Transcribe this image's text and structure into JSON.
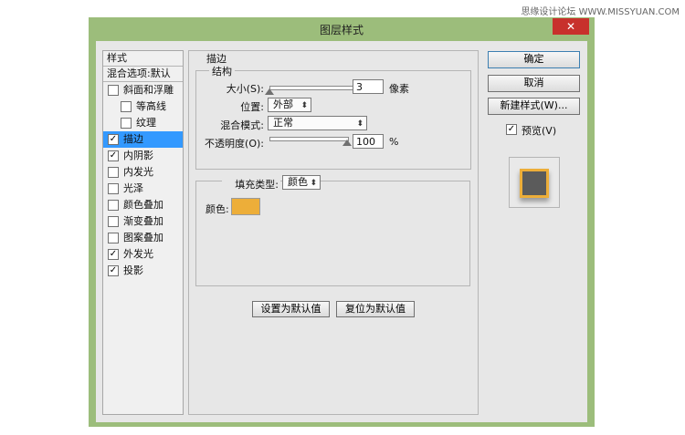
{
  "watermark": "思缘设计论坛 WWW.MISSYUAN.COM",
  "window": {
    "title": "图层样式",
    "close_glyph": "✕"
  },
  "style_list": {
    "header": "样式",
    "blend_options": "混合选项:默认",
    "items": [
      {
        "label": "斜面和浮雕",
        "checked": false,
        "indent": false,
        "selected": false
      },
      {
        "label": "等高线",
        "checked": false,
        "indent": true,
        "selected": false
      },
      {
        "label": "纹理",
        "checked": false,
        "indent": true,
        "selected": false
      },
      {
        "label": "描边",
        "checked": true,
        "indent": false,
        "selected": true
      },
      {
        "label": "内阴影",
        "checked": true,
        "indent": false,
        "selected": false
      },
      {
        "label": "内发光",
        "checked": false,
        "indent": false,
        "selected": false
      },
      {
        "label": "光泽",
        "checked": false,
        "indent": false,
        "selected": false
      },
      {
        "label": "颜色叠加",
        "checked": false,
        "indent": false,
        "selected": false
      },
      {
        "label": "渐变叠加",
        "checked": false,
        "indent": false,
        "selected": false
      },
      {
        "label": "图案叠加",
        "checked": false,
        "indent": false,
        "selected": false
      },
      {
        "label": "外发光",
        "checked": true,
        "indent": false,
        "selected": false
      },
      {
        "label": "投影",
        "checked": true,
        "indent": false,
        "selected": false
      }
    ]
  },
  "stroke": {
    "title": "描边",
    "structure": {
      "legend": "结构",
      "size_label": "大小(S):",
      "size_value": "3",
      "size_unit": "像素",
      "size_slider_fraction": 0.0,
      "position_label": "位置:",
      "position_value": "外部",
      "blend_label": "混合模式:",
      "blend_value": "正常",
      "opacity_label": "不透明度(O):",
      "opacity_value": "100",
      "opacity_unit": "%",
      "opacity_slider_fraction": 1.0
    },
    "fill": {
      "type_label": "填充类型:",
      "type_value": "颜色",
      "color_label": "颜色:",
      "color": "#edae39"
    },
    "set_default": "设置为默认值",
    "reset_default": "复位为默认值"
  },
  "actions": {
    "ok": "确定",
    "cancel": "取消",
    "new_style": "新建样式(W)...",
    "preview_label": "预览(V)",
    "preview_checked": true
  },
  "icons": {
    "check": "✓",
    "dropdown": "chevron-updown-icon",
    "dropdown_glyph": "⬍",
    "close": "close-icon"
  }
}
